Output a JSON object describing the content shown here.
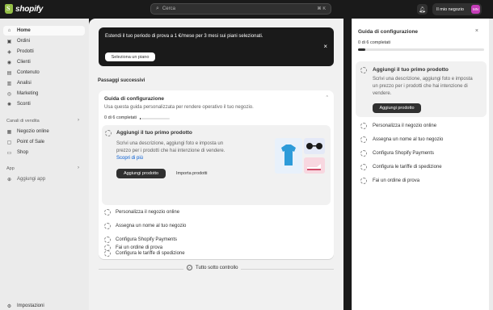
{
  "topbar": {
    "logo_text": "shopify",
    "search_placeholder": "Cerca",
    "search_shortcut": "⌘ K",
    "store_name": "Il mio negozio",
    "avatar_initials": "MN"
  },
  "sidebar": {
    "items": [
      {
        "label": "Home",
        "icon": "home-icon"
      },
      {
        "label": "Ordini",
        "icon": "orders-icon"
      },
      {
        "label": "Prodotti",
        "icon": "tag-icon"
      },
      {
        "label": "Clienti",
        "icon": "person-icon"
      },
      {
        "label": "Contenuto",
        "icon": "content-icon"
      },
      {
        "label": "Analisi",
        "icon": "analytics-icon"
      },
      {
        "label": "Marketing",
        "icon": "target-icon"
      },
      {
        "label": "Sconti",
        "icon": "discount-icon"
      }
    ],
    "sales_channels_label": "Canali di vendita",
    "channels": [
      {
        "label": "Negozio online",
        "icon": "store-icon"
      },
      {
        "label": "Point of Sale",
        "icon": "pos-icon"
      },
      {
        "label": "Shop",
        "icon": "shop-icon"
      }
    ],
    "apps_label": "App",
    "add_app_label": "Aggiungi app",
    "settings_label": "Impostazioni"
  },
  "banner": {
    "text": "Estendi il tuo periodo di prova a 1 €/mese per 3 mesi sui piani selezionati.",
    "button": "Seleziona un piano"
  },
  "main": {
    "steps_title": "Passaggi successivi",
    "guide": {
      "title": "Guida di configurazione",
      "subtitle": "Usa questa guida personalizzata per rendere operativo il tuo negozio.",
      "progress_label": "0 di 6 completati",
      "progress": 0,
      "active_step": {
        "title": "Aggiungi il tuo primo prodotto",
        "description": "Scrivi una descrizione, aggiungi foto e imposta un prezzo per i prodotti che hai intenzione di vendere.",
        "link": "Scopri di più",
        "primary_button": "Aggiungi prodotto",
        "secondary_button": "Importa prodotti"
      },
      "steps": [
        "Personalizza il negozio online",
        "Assegna un nome al tuo negozio",
        "Configura Shopify Payments",
        "Configura le tariffe di spedizione",
        "Fai un ordine di prova"
      ]
    },
    "footer_text": "Tutto sotto controllo"
  },
  "panel": {
    "title": "Guida di configurazione",
    "progress_label": "0 di 6 completati",
    "progress": 0.06,
    "active_step": {
      "title": "Aggiungi il tuo primo prodotto",
      "description": "Scrivi una descrizione, aggiungi foto e imposta un prezzo per i prodotti che hai intenzione di vendere.",
      "button": "Aggiungi prodotto"
    },
    "steps": [
      "Personalizza il negozio online",
      "Assegna un nome al tuo negozio",
      "Configura Shopify Payments",
      "Configura le tariffe di spedizione",
      "Fai un ordine di prova"
    ]
  },
  "colors": {
    "brand_green": "#95bf47",
    "dark": "#1a1a1a",
    "link": "#005bd3",
    "avatar": "#c43db8"
  }
}
